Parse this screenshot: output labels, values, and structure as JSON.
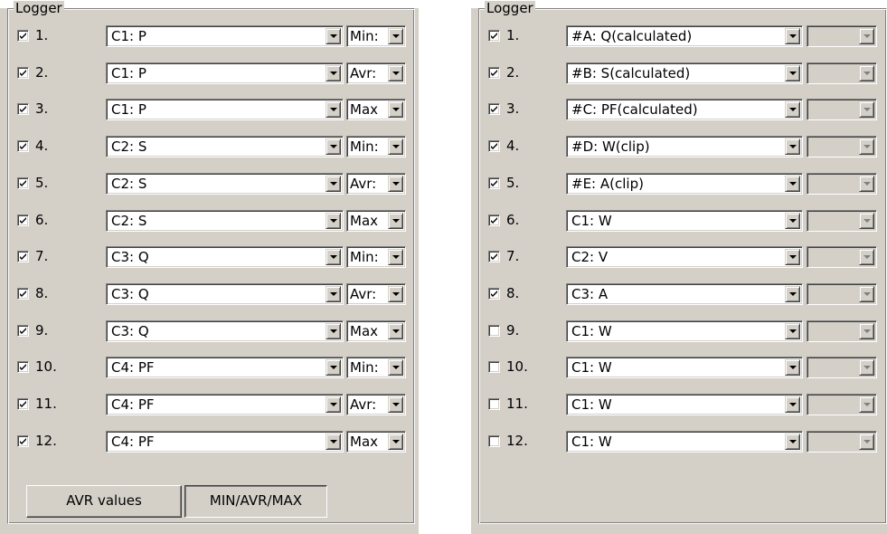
{
  "left_panel": {
    "title": "Logger",
    "rows": [
      {
        "checked": true,
        "num": "1.",
        "channel": "C1: P",
        "mode": "Min:"
      },
      {
        "checked": true,
        "num": "2.",
        "channel": "C1: P",
        "mode": "Avr:"
      },
      {
        "checked": true,
        "num": "3.",
        "channel": "C1: P",
        "mode": "Max"
      },
      {
        "checked": true,
        "num": "4.",
        "channel": "C2: S",
        "mode": "Min:"
      },
      {
        "checked": true,
        "num": "5.",
        "channel": "C2: S",
        "mode": "Avr:"
      },
      {
        "checked": true,
        "num": "6.",
        "channel": "C2: S",
        "mode": "Max"
      },
      {
        "checked": true,
        "num": "7.",
        "channel": "C3: Q",
        "mode": "Min:"
      },
      {
        "checked": true,
        "num": "8.",
        "channel": "C3: Q",
        "mode": "Avr:"
      },
      {
        "checked": true,
        "num": "9.",
        "channel": "C3: Q",
        "mode": "Max"
      },
      {
        "checked": true,
        "num": "10.",
        "channel": "C4: PF",
        "mode": "Min:"
      },
      {
        "checked": true,
        "num": "11.",
        "channel": "C4: PF",
        "mode": "Avr:"
      },
      {
        "checked": true,
        "num": "12.",
        "channel": "C4: PF",
        "mode": "Max"
      }
    ],
    "buttons": {
      "avr_label": "AVR values",
      "minavrmax_label": "MIN/AVR/MAX"
    }
  },
  "right_panel": {
    "title": "Logger",
    "rows": [
      {
        "checked": true,
        "num": "1.",
        "channel": "#A: Q(calculated)"
      },
      {
        "checked": true,
        "num": "2.",
        "channel": "#B: S(calculated)"
      },
      {
        "checked": true,
        "num": "3.",
        "channel": "#C: PF(calculated)"
      },
      {
        "checked": true,
        "num": "4.",
        "channel": "#D: W(clip)"
      },
      {
        "checked": true,
        "num": "5.",
        "channel": "#E: A(clip)"
      },
      {
        "checked": true,
        "num": "6.",
        "channel": "C1: W"
      },
      {
        "checked": true,
        "num": "7.",
        "channel": "C2: V"
      },
      {
        "checked": true,
        "num": "8.",
        "channel": "C3: A"
      },
      {
        "checked": false,
        "num": "9.",
        "channel": "C1: W"
      },
      {
        "checked": false,
        "num": "10.",
        "channel": "C1: W"
      },
      {
        "checked": false,
        "num": "11.",
        "channel": "C1: W"
      },
      {
        "checked": false,
        "num": "12.",
        "channel": "C1: W"
      }
    ]
  },
  "icons": {
    "checkbox_mark": "checkmark-icon",
    "combo_arrow": "chevron-down-icon"
  }
}
